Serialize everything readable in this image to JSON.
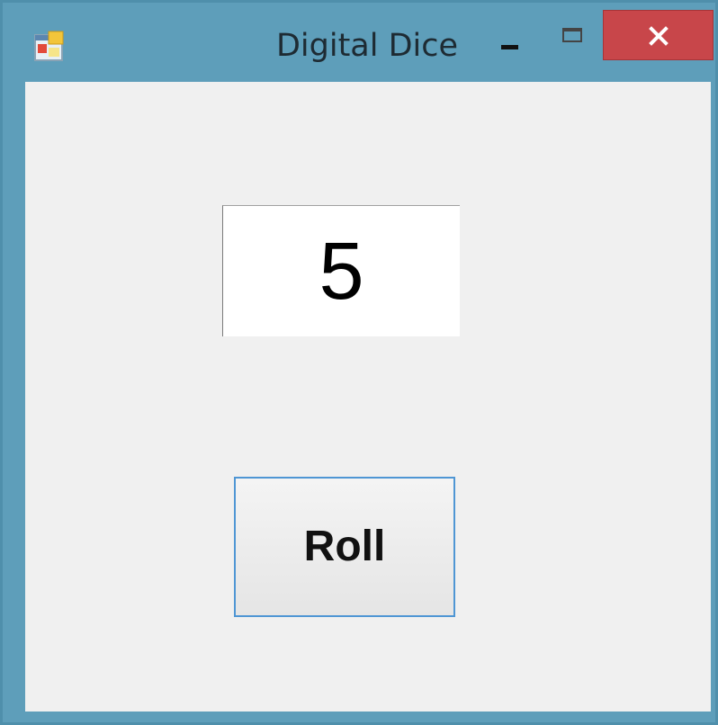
{
  "window": {
    "title": "Digital Dice",
    "icon": "app-form-icon",
    "controls": {
      "minimize": "minimize-icon",
      "maximize": "maximize-icon",
      "close": "close-icon"
    },
    "colors": {
      "frame": "#5e9eba",
      "close_button": "#c8464a",
      "client_background": "#f0f0f0"
    }
  },
  "main": {
    "result_value": "5",
    "roll_button_label": "Roll"
  }
}
